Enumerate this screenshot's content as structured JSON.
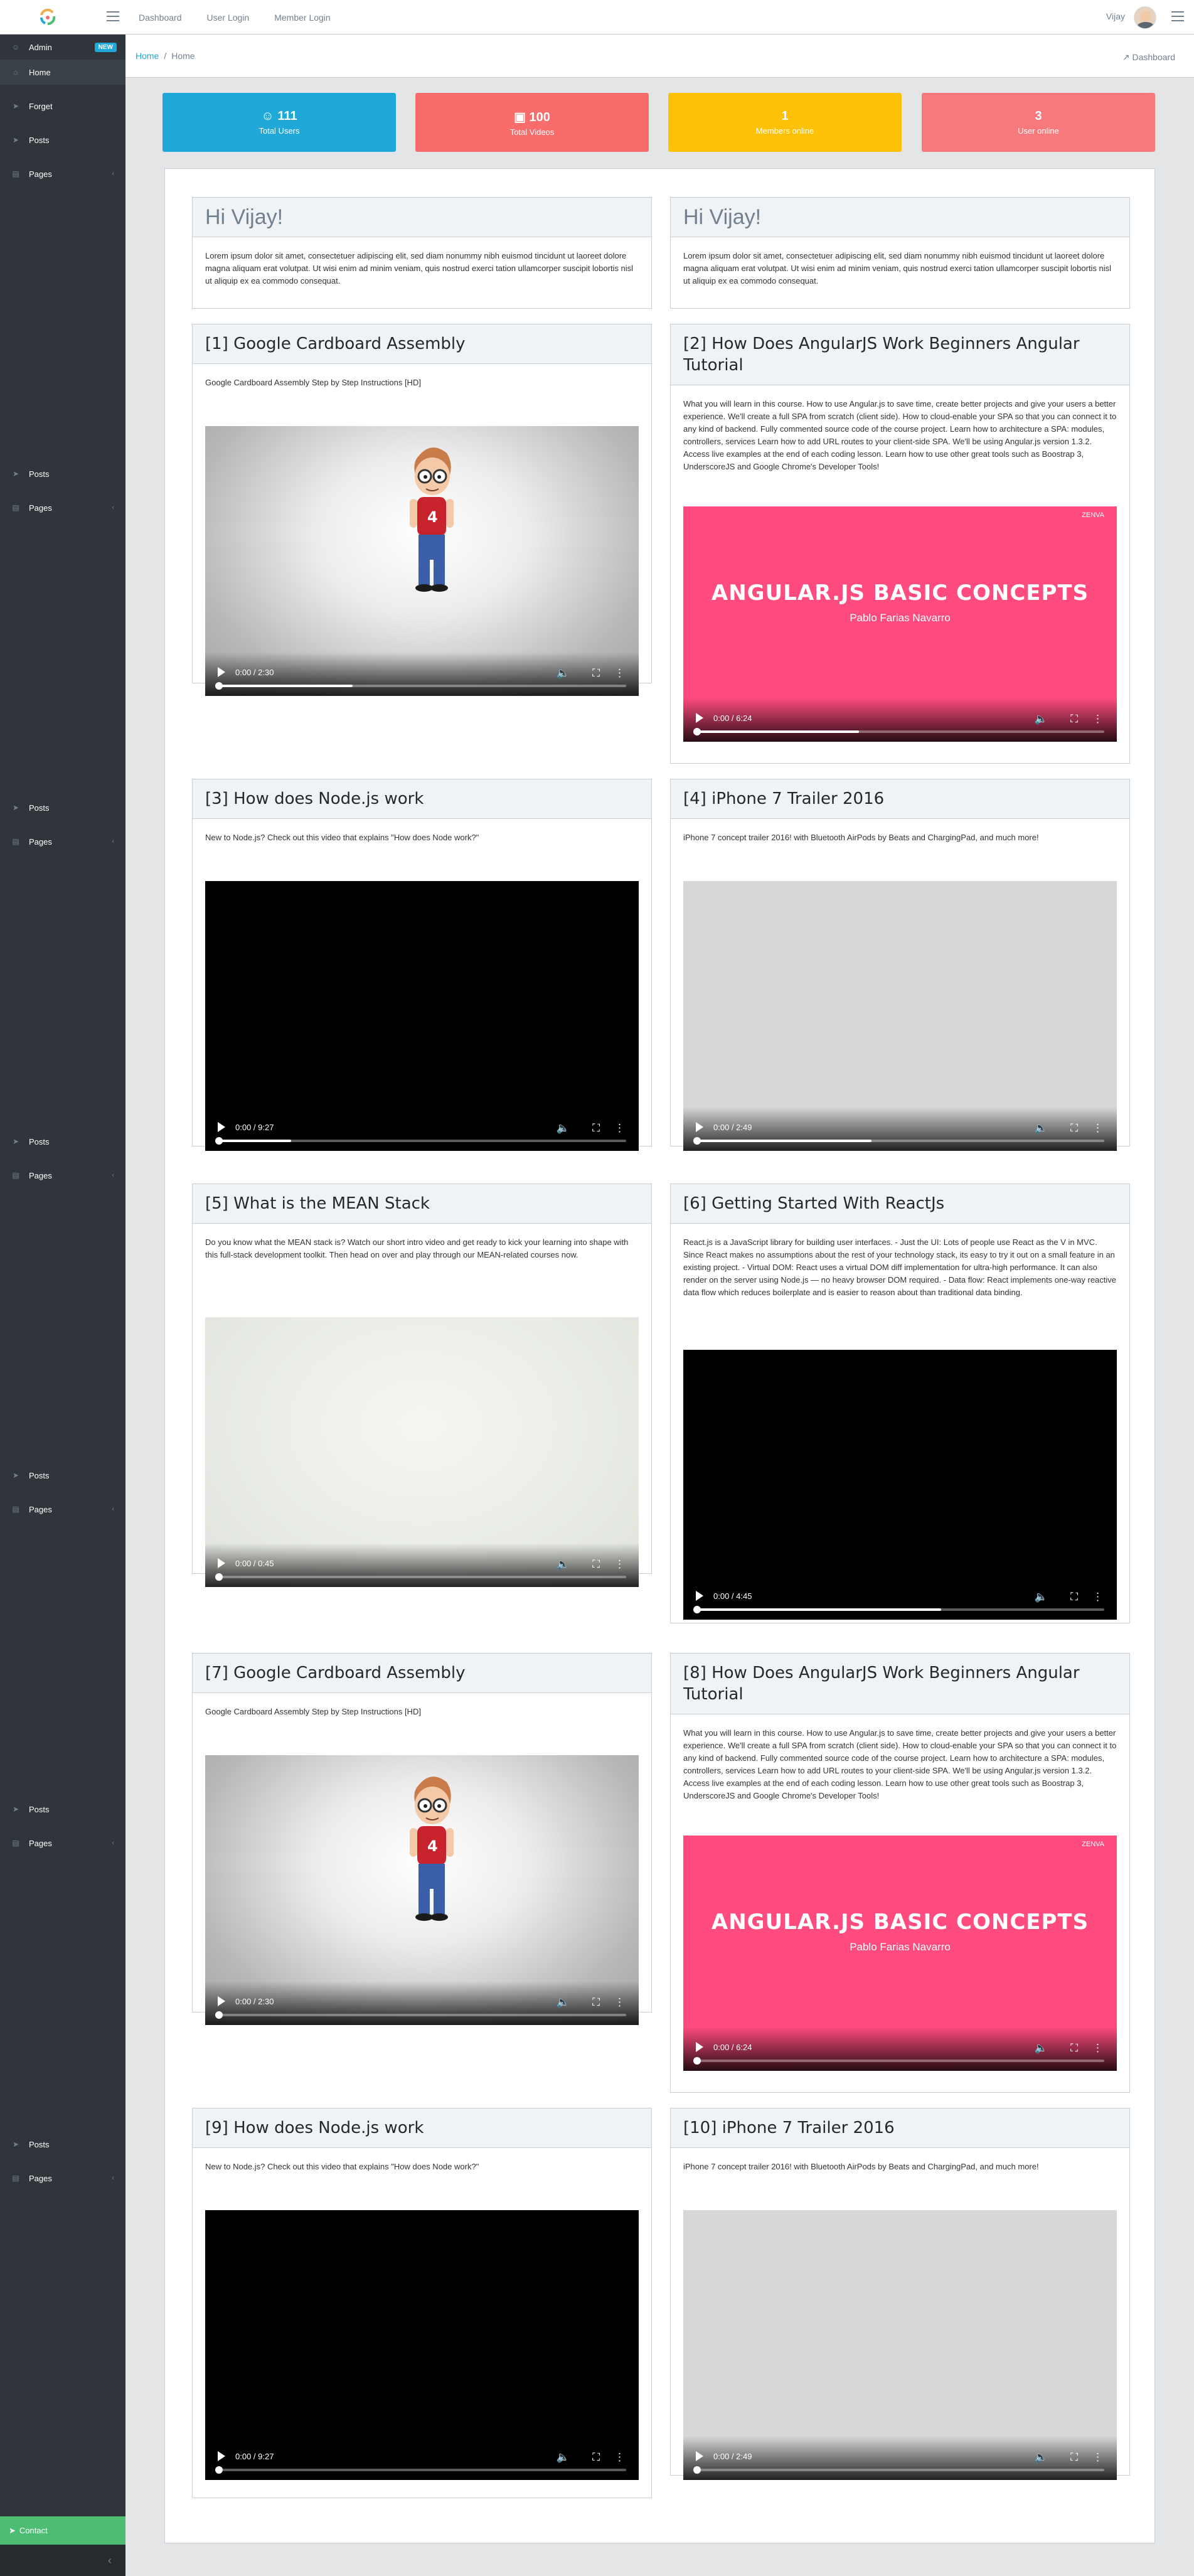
{
  "header": {
    "nav": [
      "Dashboard",
      "User Login",
      "Member Login"
    ],
    "user_name": "Vijay"
  },
  "sidebar": {
    "items": [
      {
        "label": "Admin",
        "icon": "user-icon",
        "badge": "NEW"
      },
      {
        "label": "Home",
        "icon": "home-icon"
      },
      {
        "label": "Forget",
        "icon": "paper-plane-icon"
      },
      {
        "label": "Posts",
        "icon": "paper-plane-icon"
      },
      {
        "label": "Pages",
        "icon": "page-icon"
      }
    ],
    "repeat_labels": {
      "posts": "Posts",
      "pages": "Pages"
    },
    "contact": "Contact",
    "colors": {
      "bg": "#2f353a",
      "contact": "#4dbd74"
    }
  },
  "breadcrumb": {
    "items": [
      "Home",
      "Home"
    ],
    "right": "Dashboard"
  },
  "stats": [
    {
      "value": "111",
      "label": "Total Users",
      "icon": "users-icon",
      "color": "#20a8d8"
    },
    {
      "value": "100",
      "label": "Total Videos",
      "icon": "film-icon",
      "color": "#f86c6b"
    },
    {
      "value": "1",
      "label": "Members online",
      "icon": "",
      "color": "#ffc107"
    },
    {
      "value": "3",
      "label": "User online",
      "icon": "",
      "color": "#f7797c"
    }
  ],
  "greetings": [
    {
      "title": "Hi Vijay!",
      "text": "Lorem ipsum dolor sit amet, consectetuer adipiscing elit, sed diam nonummy nibh euismod tincidunt ut laoreet dolore magna aliquam erat volutpat. Ut wisi enim ad minim veniam, quis nostrud exerci tation ullamcorper suscipit lobortis nisl ut aliquip ex ea commodo consequat."
    },
    {
      "title": "Hi Vijay!",
      "text": "Lorem ipsum dolor sit amet, consectetuer adipiscing elit, sed diam nonummy nibh euismod tincidunt ut laoreet dolore magna aliquam erat volutpat. Ut wisi enim ad minim veniam, quis nostrud exerci tation ullamcorper suscipit lobortis nisl ut aliquip ex ea commodo consequat."
    }
  ],
  "videos": [
    {
      "title": "[1] Google Cardboard Assembly",
      "desc": "Google Cardboard Assembly Step by Step Instructions [HD]",
      "time": "0:00 / 2:30",
      "poster": "cartoon",
      "progress": 0.33
    },
    {
      "title": "[2] How Does AngularJS Work Beginners Angular Tutorial",
      "desc": "What you will learn in this course. How to use Angular.js to save time, create better projects and give your users a better experience. We'll create a full SPA from scratch (client side). How to cloud-enable your SPA so that you can connect it to any kind of backend. Fully commented source code of the course project. Learn how to architecture a SPA: modules, controllers, services Learn how to add URL routes to your client-side SPA. We'll be using Angular.js version 1.3.2. Access live examples at the end of each coding lesson. Learn how to use other great tools such as Boostrap 3, UnderscoreJS and Google Chrome's Developer Tools!",
      "time": "0:00 / 6:24",
      "poster": "angular",
      "progress": 0.4
    },
    {
      "title": "[3] How does Node.js work",
      "desc": "New to Node.js? Check out this video that explains \"How does Node work?\"",
      "time": "0:00 / 9:27",
      "poster": "black",
      "progress": 0.18
    },
    {
      "title": "[4] iPhone 7 Trailer 2016",
      "desc": "iPhone 7 concept trailer 2016! with Bluetooth AirPods by Beats and ChargingPad, and much more!",
      "time": "0:00 / 2:49",
      "poster": "gray",
      "progress": 0.43
    },
    {
      "title": "[5] What is the MEAN Stack",
      "desc": "Do you know what the MEAN stack is? Watch our short intro video and get ready to kick your learning into shape with this full-stack development toolkit. Then head on over and play through our MEAN-related courses now.",
      "time": "0:00 / 0:45",
      "poster": "pale",
      "progress": 0.0
    },
    {
      "title": "[6] Getting Started With ReactJs",
      "desc": "React.js is a JavaScript library for building user interfaces. - Just the UI: Lots of people use React as the V in MVC. Since React makes no assumptions about the rest of your technology stack, its easy to try it out on a small feature in an existing project. - Virtual DOM: React uses a virtual DOM diff implementation for ultra-high performance. It can also render on the server using Node.js — no heavy browser DOM required. - Data flow: React implements one-way reactive data flow which reduces boilerplate and is easier to reason about than traditional data binding.",
      "time": "0:00 / 4:45",
      "poster": "black",
      "progress": 0.6
    },
    {
      "title": "[7] Google Cardboard Assembly",
      "desc": "Google Cardboard Assembly Step by Step Instructions [HD]",
      "time": "0:00 / 2:30",
      "poster": "cartoon",
      "progress": 0.0
    },
    {
      "title": "[8] How Does AngularJS Work Beginners Angular Tutorial",
      "desc": "What you will learn in this course. How to use Angular.js to save time, create better projects and give your users a better experience. We'll create a full SPA from scratch (client side). How to cloud-enable your SPA so that you can connect it to any kind of backend. Fully commented source code of the course project. Learn how to architecture a SPA: modules, controllers, services Learn how to add URL routes to your client-side SPA. We'll be using Angular.js version 1.3.2. Access live examples at the end of each coding lesson. Learn how to use other great tools such as Boostrap 3, UnderscoreJS and Google Chrome's Developer Tools!",
      "time": "0:00 / 6:24",
      "poster": "angular",
      "progress": 0.0
    },
    {
      "title": "[9] How does Node.js work",
      "desc": "New to Node.js? Check out this video that explains \"How does Node work?\"",
      "time": "0:00 / 9:27",
      "poster": "black",
      "progress": 0.0
    },
    {
      "title": "[10] iPhone 7 Trailer 2016",
      "desc": "iPhone 7 concept trailer 2016! with Bluetooth AirPods by Beats and ChargingPad, and much more!",
      "time": "0:00 / 2:49",
      "poster": "gray",
      "progress": 0.0
    }
  ],
  "angular_poster": {
    "title": "ANGULAR.JS BASIC CONCEPTS",
    "author": "Pablo Farias Navarro",
    "brand": "ZENVA"
  }
}
